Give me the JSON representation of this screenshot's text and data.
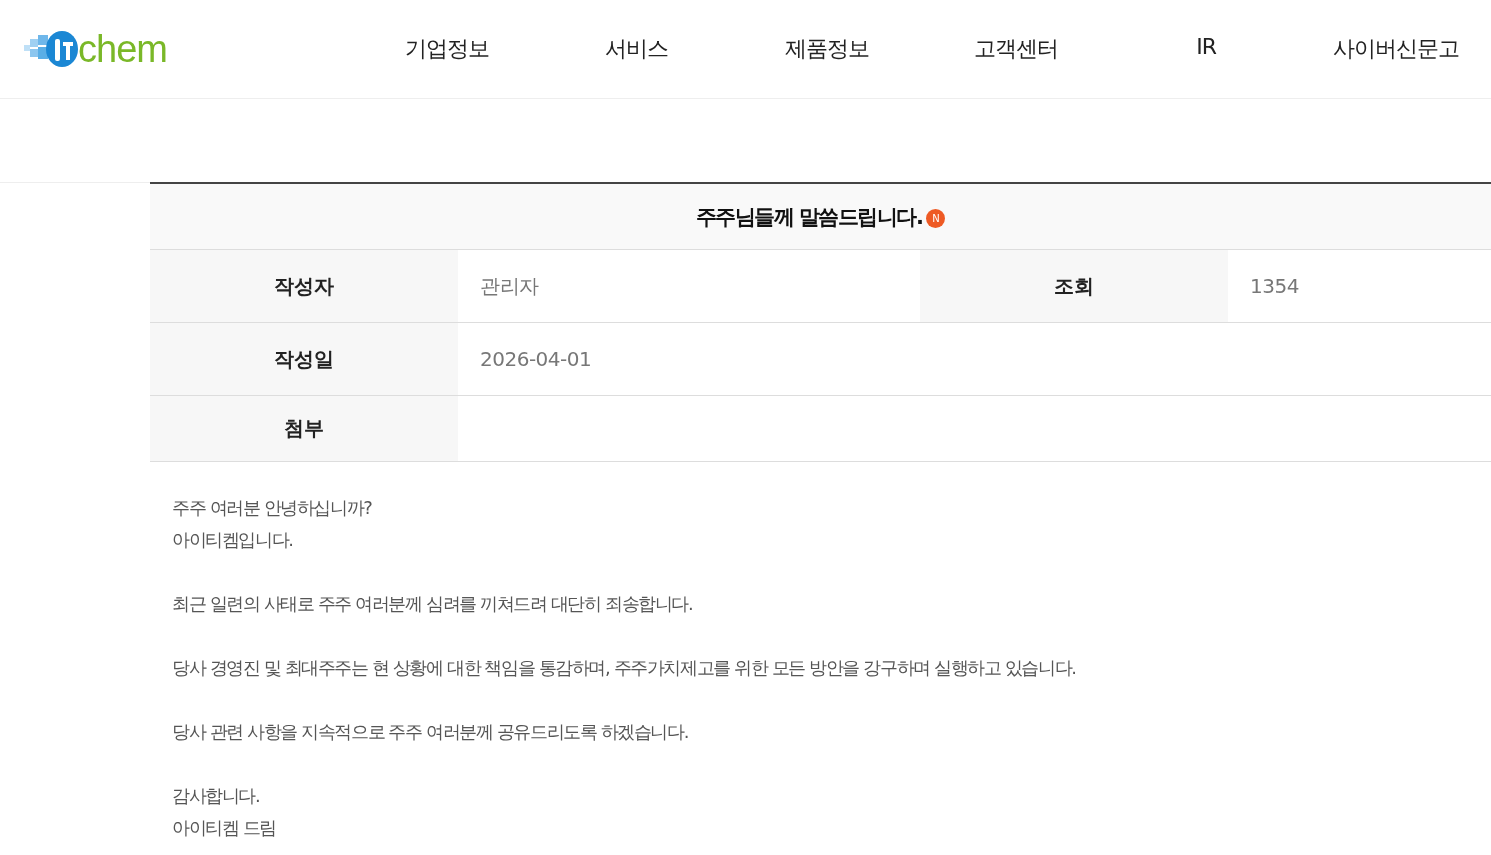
{
  "header": {
    "logo_text": "chem",
    "nav": [
      {
        "label": "기업정보",
        "selected": false
      },
      {
        "label": "서비스",
        "selected": false
      },
      {
        "label": "제품정보",
        "selected": false
      },
      {
        "label": "고객센터",
        "selected": false
      },
      {
        "label": "IR",
        "selected": false
      },
      {
        "label": "사이버신문고",
        "selected": false
      }
    ]
  },
  "post": {
    "title": "주주님들께 말씀드립니다.",
    "new_badge": "N",
    "meta": [
      [
        {
          "label": "작성자",
          "value": "관리자"
        },
        {
          "label": "조회",
          "value": "1354"
        }
      ],
      [
        {
          "label": "작성일",
          "value": "2026-04-01"
        }
      ],
      [
        {
          "label": "첨부"
        }
      ]
    ],
    "paragraphs": [
      [
        "주주 여러분 안녕하십니까?",
        "아이티켐입니다."
      ],
      [
        "최근 일련의 사태로 주주 여러분께 심려를 끼쳐드려 대단히 죄송합니다."
      ],
      [
        "당사 경영진 및 최대주주는 현 상황에 대한 책임을 통감하며, 주주가치제고를 위한 모든 방안을 강구하며 실행하고 있습니다."
      ],
      [
        "당사 관련 사항을 지속적으로 주주 여러분께 공유드리도록 하겠습니다."
      ],
      [
        "감사합니다.",
        "아이티켐 드림"
      ]
    ]
  }
}
